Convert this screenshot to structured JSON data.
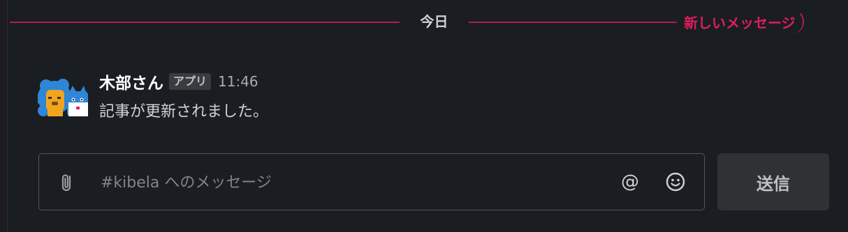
{
  "divider": {
    "date_label": "今日",
    "new_messages_label": "新しいメッセージ"
  },
  "message": {
    "sender": "木部さん",
    "badge": "アプリ",
    "time": "11:46",
    "body": "記事が更新されました。",
    "avatar_icon": "kibela-mascot-icon"
  },
  "composer": {
    "placeholder": "#kibela へのメッセージ",
    "value": "",
    "attach_icon": "paperclip-icon",
    "mention_icon": "at-icon",
    "emoji_icon": "smiley-icon",
    "send_label": "送信"
  },
  "colors": {
    "background": "#1a1d21",
    "divider_accent": "#e01e5a",
    "send_button": "#303134"
  }
}
